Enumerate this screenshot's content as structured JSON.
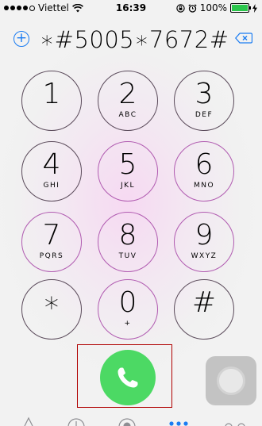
{
  "status_bar": {
    "carrier": "Viettel",
    "time": "16:39",
    "battery_percent": "100%",
    "battery_level": 1.0,
    "signal_bars": 4,
    "icons": [
      "wifi-icon",
      "lock-rotation-icon",
      "alarm-icon",
      "charging-bolt-icon"
    ]
  },
  "dialer": {
    "dialed_number": "∗#5005∗7672#",
    "add_contact_icon": "plus-circle-icon",
    "backspace_icon": "backspace-icon"
  },
  "keypad": [
    {
      "digit": "1",
      "letters": ""
    },
    {
      "digit": "2",
      "letters": "ABC"
    },
    {
      "digit": "3",
      "letters": "DEF"
    },
    {
      "digit": "4",
      "letters": "GHI"
    },
    {
      "digit": "5",
      "letters": "JKL"
    },
    {
      "digit": "6",
      "letters": "MNO"
    },
    {
      "digit": "7",
      "letters": "PQRS"
    },
    {
      "digit": "8",
      "letters": "TUV"
    },
    {
      "digit": "9",
      "letters": "WXYZ"
    },
    {
      "digit": "∗",
      "letters": ""
    },
    {
      "digit": "0",
      "letters": "+"
    },
    {
      "digit": "#",
      "letters": ""
    }
  ],
  "call_button_icon": "phone-icon",
  "colors": {
    "accent": "#1a7cf2",
    "call_green": "#4cd964",
    "highlight_box": "#b00000",
    "battery_green": "#2bc64c"
  }
}
